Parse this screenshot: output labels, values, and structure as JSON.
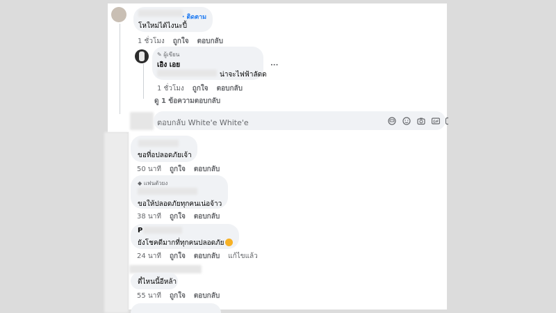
{
  "thread": {
    "comment1": {
      "follow": "· ติดตาม",
      "text": "โหใหม่ได้ไงนะปี้",
      "time": "1 ชั่วโมง",
      "like": "ถูกใจ",
      "reply": "ตอบกลับ"
    },
    "reply1": {
      "badge": "✎ ผู้เขียน",
      "author": "เอิง เอย",
      "text": "น่าจะไฟฟ้าลัดด",
      "more": "...",
      "time": "1 ชั่วโมง",
      "like": "ถูกใจ",
      "reply": "ตอบกลับ"
    },
    "view_replies": "ดู 1 ข้อความตอบกลับ",
    "reply_box": {
      "placeholder": "ตอบกลับ White'e White'e"
    }
  },
  "comments": [
    {
      "text": "ขอที่อปลอดภัยเจ้า",
      "time": "50 นาที",
      "like": "ถูกใจ",
      "reply": "ตอบกลับ"
    },
    {
      "badge": "แฟนตัวยง",
      "text": "ขอให้ปลอดภัยทุกคนเน่อจ้าว",
      "time": "38 นาที",
      "like": "ถูกใจ",
      "reply": "ตอบกลับ"
    },
    {
      "initial": "P",
      "text": "ยังโชคดีมากที่ทุกคนปลอดภัย",
      "time": "24 นาที",
      "like": "ถูกใจ",
      "reply": "ตอบกลับ",
      "edited": "แก้ไขแล้ว"
    },
    {
      "text": "ตี๋ไหนนี้อีหล้า",
      "time": "55 นาที",
      "like": "ถูกใจ",
      "reply": "ตอบกลับ"
    }
  ],
  "colors": {
    "link": "#1877f2",
    "bubble": "#f0f2f5",
    "meta": "#65676b"
  }
}
